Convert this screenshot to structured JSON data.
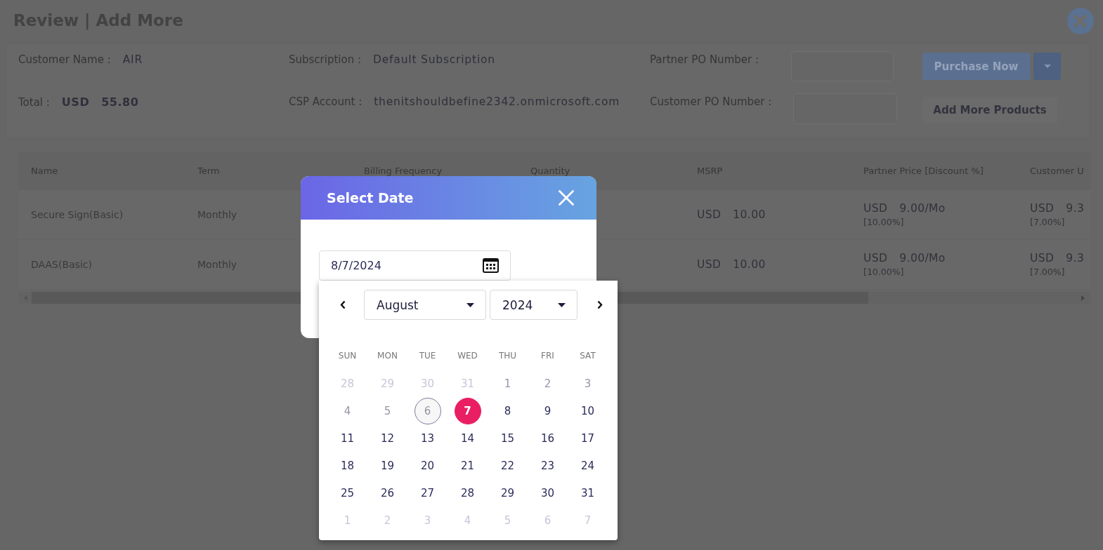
{
  "page": {
    "title": "Review | Add More"
  },
  "summary": {
    "customer_name": {
      "label": "Customer Name :",
      "value": "AIR"
    },
    "total": {
      "label": "Total :",
      "currency": "USD",
      "amount": "55.80"
    },
    "subscription": {
      "label": "Subscription :",
      "value": "Default Subscription"
    },
    "csp_account": {
      "label": "CSP Account :",
      "value": "thenitshouldbefine2342.onmicrosoft.com"
    },
    "partner_po": {
      "label": "Partner PO Number :"
    },
    "customer_po": {
      "label": "Customer PO Number :"
    }
  },
  "actions": {
    "purchase": "Purchase Now",
    "add_more": "Add More Products"
  },
  "table": {
    "columns": [
      "Name",
      "Term",
      "Billing Frequency",
      "Quantity",
      "MSRP",
      "Partner Price [Discount %]",
      "Customer U"
    ],
    "rows": [
      {
        "name": "Secure Sign(Basic)",
        "term": "Monthly",
        "msrp": {
          "currency": "USD",
          "amount": "10.00"
        },
        "partner_price": {
          "currency": "USD",
          "amount": "9.00/Mo",
          "discount": "[10.00%]"
        },
        "customer_price": {
          "currency": "USD",
          "amount": "9.3",
          "discount": "[7.00%]"
        }
      },
      {
        "name": "DAAS(Basic)",
        "term": "Monthly",
        "msrp": {
          "currency": "USD",
          "amount": "10.00"
        },
        "partner_price": {
          "currency": "USD",
          "amount": "9.00/Mo",
          "discount": "[10.00%]"
        },
        "customer_price": {
          "currency": "USD",
          "amount": "9.3",
          "discount": "[7.00%]"
        }
      }
    ]
  },
  "dialog": {
    "title": "Select Date",
    "date_value": "8/7/2024",
    "calendar": {
      "month": "August",
      "year": "2024",
      "weekdays": [
        "SUN",
        "MON",
        "TUE",
        "WED",
        "THU",
        "FRI",
        "SAT"
      ],
      "days": [
        {
          "label": "28",
          "kind": "outside",
          "today": false,
          "selected": false
        },
        {
          "label": "29",
          "kind": "outside",
          "today": false,
          "selected": false
        },
        {
          "label": "30",
          "kind": "outside",
          "today": false,
          "selected": false
        },
        {
          "label": "31",
          "kind": "outside",
          "today": false,
          "selected": false
        },
        {
          "label": "1",
          "kind": "past",
          "today": false,
          "selected": false
        },
        {
          "label": "2",
          "kind": "past",
          "today": false,
          "selected": false
        },
        {
          "label": "3",
          "kind": "past",
          "today": false,
          "selected": false
        },
        {
          "label": "4",
          "kind": "past",
          "today": false,
          "selected": false
        },
        {
          "label": "5",
          "kind": "past",
          "today": false,
          "selected": false
        },
        {
          "label": "6",
          "kind": "past",
          "today": true,
          "selected": false
        },
        {
          "label": "7",
          "kind": "day",
          "today": false,
          "selected": true
        },
        {
          "label": "8",
          "kind": "day",
          "today": false,
          "selected": false
        },
        {
          "label": "9",
          "kind": "day",
          "today": false,
          "selected": false
        },
        {
          "label": "10",
          "kind": "day",
          "today": false,
          "selected": false
        },
        {
          "label": "11",
          "kind": "day",
          "today": false,
          "selected": false
        },
        {
          "label": "12",
          "kind": "day",
          "today": false,
          "selected": false
        },
        {
          "label": "13",
          "kind": "day",
          "today": false,
          "selected": false
        },
        {
          "label": "14",
          "kind": "day",
          "today": false,
          "selected": false
        },
        {
          "label": "15",
          "kind": "day",
          "today": false,
          "selected": false
        },
        {
          "label": "16",
          "kind": "day",
          "today": false,
          "selected": false
        },
        {
          "label": "17",
          "kind": "day",
          "today": false,
          "selected": false
        },
        {
          "label": "18",
          "kind": "day",
          "today": false,
          "selected": false
        },
        {
          "label": "19",
          "kind": "day",
          "today": false,
          "selected": false
        },
        {
          "label": "20",
          "kind": "day",
          "today": false,
          "selected": false
        },
        {
          "label": "21",
          "kind": "day",
          "today": false,
          "selected": false
        },
        {
          "label": "22",
          "kind": "day",
          "today": false,
          "selected": false
        },
        {
          "label": "23",
          "kind": "day",
          "today": false,
          "selected": false
        },
        {
          "label": "24",
          "kind": "day",
          "today": false,
          "selected": false
        },
        {
          "label": "25",
          "kind": "day",
          "today": false,
          "selected": false
        },
        {
          "label": "26",
          "kind": "day",
          "today": false,
          "selected": false
        },
        {
          "label": "27",
          "kind": "day",
          "today": false,
          "selected": false
        },
        {
          "label": "28",
          "kind": "day",
          "today": false,
          "selected": false
        },
        {
          "label": "29",
          "kind": "day",
          "today": false,
          "selected": false
        },
        {
          "label": "30",
          "kind": "day",
          "today": false,
          "selected": false
        },
        {
          "label": "31",
          "kind": "day",
          "today": false,
          "selected": false
        },
        {
          "label": "1",
          "kind": "outside",
          "today": false,
          "selected": false
        },
        {
          "label": "2",
          "kind": "outside",
          "today": false,
          "selected": false
        },
        {
          "label": "3",
          "kind": "outside",
          "today": false,
          "selected": false
        },
        {
          "label": "4",
          "kind": "outside",
          "today": false,
          "selected": false
        },
        {
          "label": "5",
          "kind": "outside",
          "today": false,
          "selected": false
        },
        {
          "label": "6",
          "kind": "outside",
          "today": false,
          "selected": false
        },
        {
          "label": "7",
          "kind": "outside",
          "today": false,
          "selected": false
        }
      ]
    }
  }
}
